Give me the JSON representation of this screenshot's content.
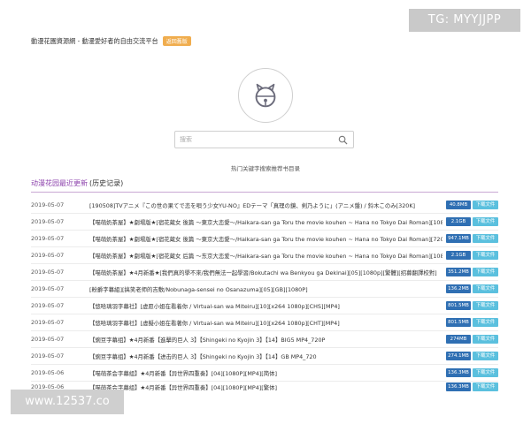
{
  "overlays": {
    "tg_banner": "TG: MYYJJPP",
    "watermark": "www.12537.co"
  },
  "header": {
    "site_tagline": "動漫花園資源網 - 動漫愛好者的自由交流平台",
    "badge": "返回舊版"
  },
  "search": {
    "placeholder": "搜索",
    "hot_text": "热门关键字搜索推荐书目录"
  },
  "section": {
    "title": "动漫花园最近更新",
    "history": "(历史记录)"
  },
  "download_label": "下载文件",
  "rows": [
    {
      "date": "2019-05-07",
      "title": "[190508]TVアニメ『この世の果てで恋を唄う少女YU-NO』EDテーマ「真理の鏡、剣乃ように」(アニメ盤) / 鈴木このみ[320K]",
      "size": "40.8MB"
    },
    {
      "date": "2019-05-07",
      "title": "【喵萌奶茶屋】★劇場版★[宿花蔵女 後篇 ～東京大恋愛～/Haikara-san ga Toru the movie kouhen ~ Hana no Tokyo Dai Roman][1080p][繁體]",
      "size": "2.1GB"
    },
    {
      "date": "2019-05-07",
      "title": "【喵萌奶茶屋】★劇場版★[宿花蔵女 後篇 ～東京大恋愛～/Haikara-san ga Toru the movie kouhen ~ Hana no Tokyo Dai Roman][720p][繁體]",
      "size": "947.1MB"
    },
    {
      "date": "2019-05-07",
      "title": "【喵萌奶茶屋】★劇場版★[宿花蔵女 后篇 ～东京大恋爱～/Haikara-san ga Toru the movie kouhen ~ Hana no Tokyo Dai Roman][1080p][简体]",
      "size": "2.1GB"
    },
    {
      "date": "2019-05-07",
      "title": "【喵萌奶茶屋】★4月新番★[我們真的學不來/我們無法一起學習/Bokutachi wa Benkyou ga Dekinai][05][1080p][繁體][招募翻譯校對]",
      "size": "351.2MB"
    },
    {
      "date": "2019-05-07",
      "title": "[粉爵字幕組][搞笑老师的吉敷/Nobunaga-sensei no Osanazuma][05][GB][1080P]",
      "size": "136.2MB"
    },
    {
      "date": "2019-05-07",
      "title": "【悠哈璃羽字幕社】[虚愿小姐在看着你 / Virtual-san wa Miteiru][10][x264 1080p][CHS][MP4]",
      "size": "801.5MB"
    },
    {
      "date": "2019-05-07",
      "title": "【悠哈璃羽字幕社】[虛擬小姐在看著你 / Virtual-san wa Miteiru][10][x264 1080p][CHT][MP4]",
      "size": "801.5MB"
    },
    {
      "date": "2019-05-07",
      "title": "【豌豆字幕组】★4月新番【進擊的巨人 3】【Shingeki no Kyojin 3】【14】BIG5 MP4_720P",
      "size": "274MB"
    },
    {
      "date": "2019-05-07",
      "title": "【豌豆字幕组】★4月新番【进击的巨人 3】【Shingeki no Kyojin 3】【14】GB MP4_720",
      "size": "274.1MB"
    },
    {
      "date": "2019-05-06",
      "title": "【喵萌茶会字幕组】★4月新番【异世界四重奏】[04][1080P][MP4][简体]",
      "size": "136.3MB"
    }
  ],
  "partial_row": {
    "date": "2019-05-06",
    "title": "【喵萌茶会字幕组】★4月新番【异世界四重奏】[04][1080P][MP4][繁体]",
    "size": "136.3MB"
  },
  "colors": {
    "accent_purple": "#8e44ad",
    "size_badge": "#2f6fb3",
    "download_badge": "#5bc0de",
    "top_badge": "#f0ad4e"
  }
}
